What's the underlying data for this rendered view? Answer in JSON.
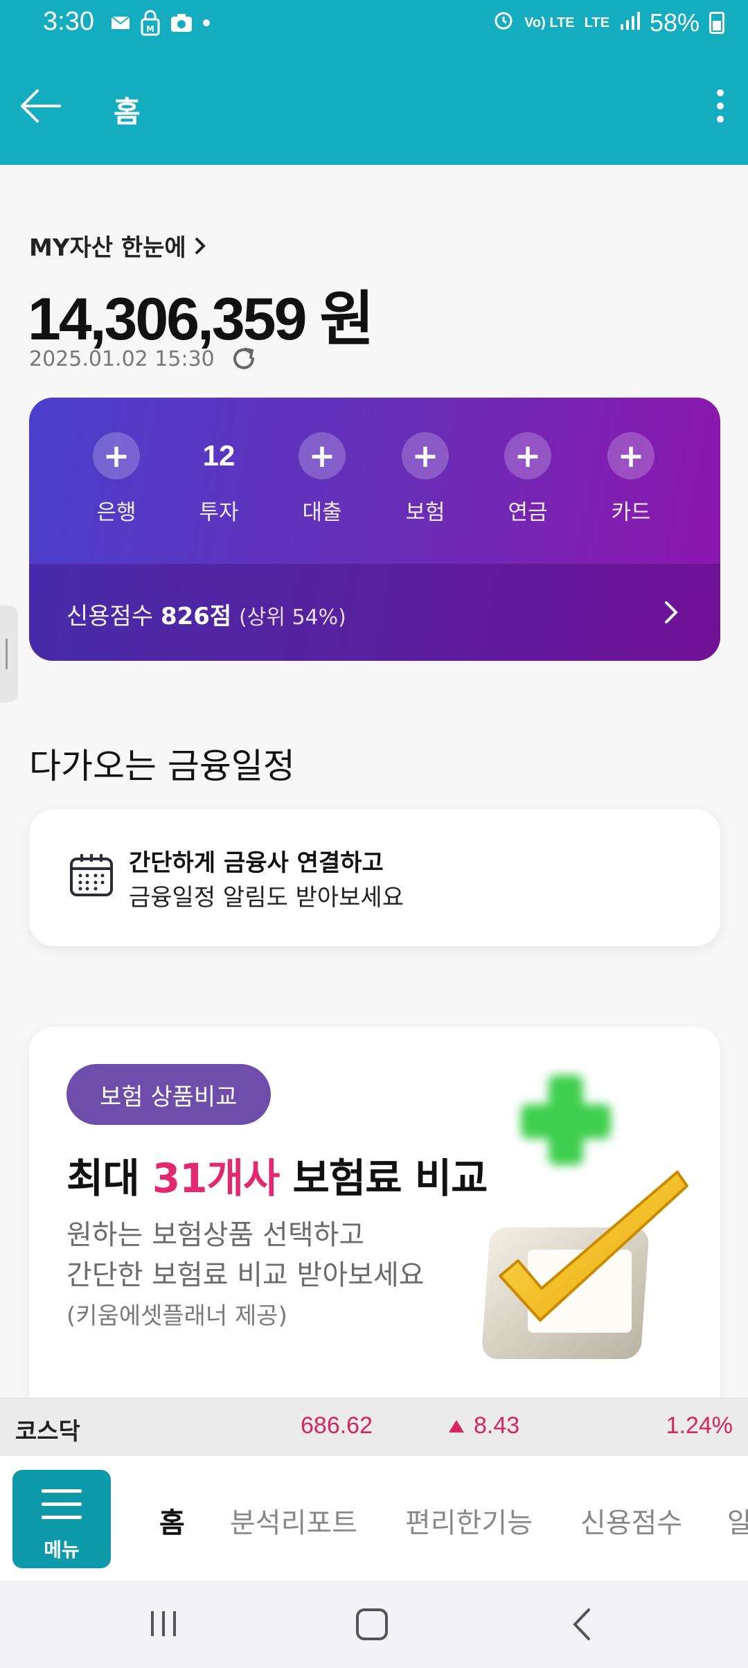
{
  "status_bar": {
    "time": "3:30",
    "network": "LTE",
    "volte": "Vo) LTE",
    "battery": "58%",
    "icons": [
      "mail-icon",
      "lock-icon",
      "camera-icon",
      "dot-icon",
      "alarm-icon",
      "signal-icon",
      "battery-icon"
    ]
  },
  "app_bar": {
    "title": "홈",
    "back_icon": "arrow-left-icon",
    "more_icon": "more-vertical-icon"
  },
  "assets": {
    "link_label": "MY자산 한눈에",
    "total": "14,306,359 원",
    "updated_at": "2025.01.02 15:30"
  },
  "summary_card": {
    "categories": [
      {
        "label": "은행",
        "value": "+"
      },
      {
        "label": "투자",
        "value": "12"
      },
      {
        "label": "대출",
        "value": "+"
      },
      {
        "label": "보험",
        "value": "+"
      },
      {
        "label": "연금",
        "value": "+"
      },
      {
        "label": "카드",
        "value": "+"
      }
    ],
    "credit_label": "신용점수",
    "credit_score": "826점",
    "credit_rank": "(상위 54%)"
  },
  "schedule": {
    "title": "다가오는 금융일정",
    "line1": "간단하게 금융사 연결하고",
    "line2": "금융일정 알림도 받아보세요"
  },
  "insurance": {
    "badge": "보험 상품비교",
    "headline_pre": "최대 ",
    "headline_accent": "31개사",
    "headline_post": " 보험료 비교",
    "desc1": "원하는 보험상품 선택하고",
    "desc2": "간단한 보험료 비교 받아보세요",
    "note": "(키움에셋플래너 제공)",
    "accent_color": "#e2286f"
  },
  "ticker": {
    "name": "코스닥",
    "value": "686.62",
    "change": "8.43",
    "percent": "1.24%",
    "color": "#d8245f"
  },
  "tabs": {
    "menu_label": "메뉴",
    "items": [
      "홈",
      "분석리포트",
      "편리한기능",
      "신용점수",
      "알"
    ]
  },
  "colors": {
    "primary": "#14adc0",
    "menu": "#0f9aaa",
    "card_gradient_start": "#4a3fcb",
    "card_gradient_end": "#8e15ad"
  }
}
